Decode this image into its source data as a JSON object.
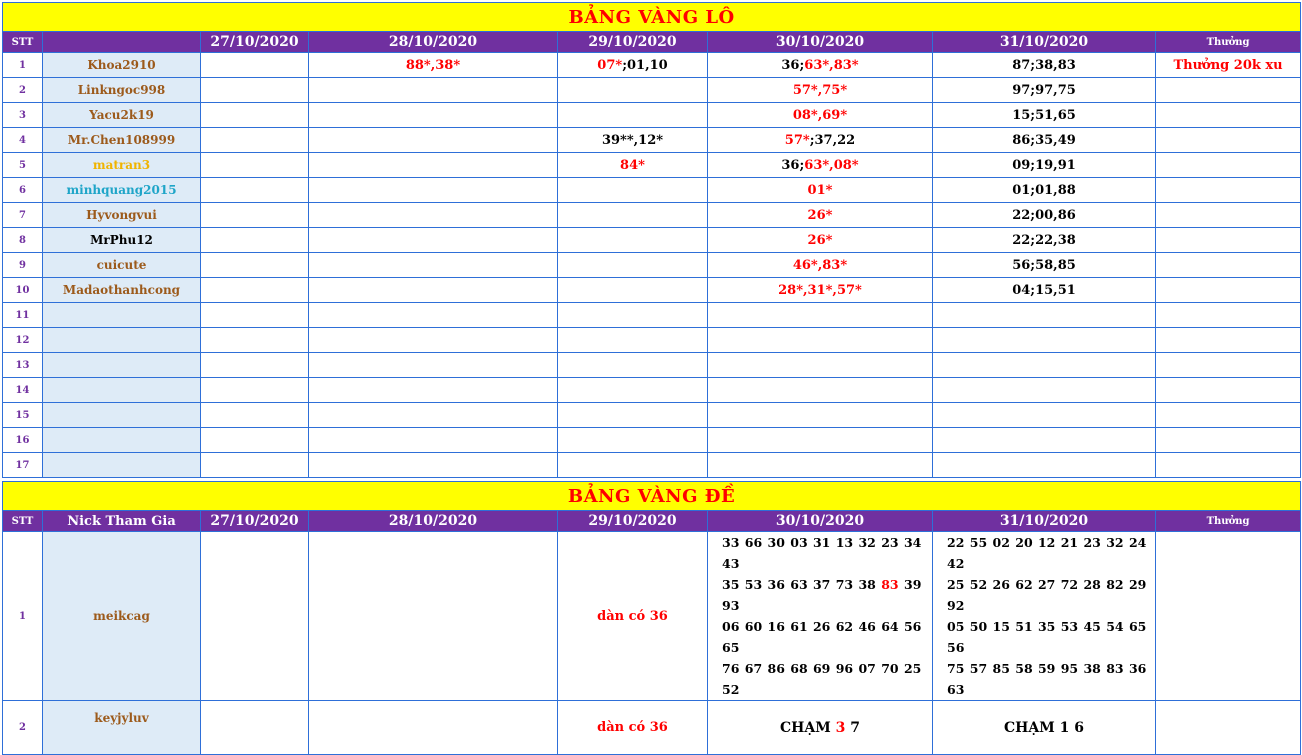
{
  "lo": {
    "title": "BẢNG VÀNG LÔ",
    "headers": {
      "stt": "STT",
      "nick": "",
      "dates": [
        "27/10/2020",
        "28/10/2020",
        "29/10/2020",
        "30/10/2020",
        "31/10/2020"
      ],
      "reward": "Thưởng"
    },
    "rows": [
      {
        "stt": "1",
        "nick": "Khoa2910",
        "nick_color": "#9c5a1b",
        "d1": [],
        "d2": [
          {
            "t": "88*,38*",
            "c": "#ff0000"
          }
        ],
        "d3": [
          {
            "t": "07*",
            "c": "#ff0000"
          },
          {
            "t": ";01,10",
            "c": "#000000"
          }
        ],
        "d4": [
          {
            "t": "36;",
            "c": "#000000"
          },
          {
            "t": "63*,83*",
            "c": "#ff0000"
          }
        ],
        "d5": [
          {
            "t": "87;38,83",
            "c": "#000000"
          }
        ],
        "reward": "Thưởng 20k xu"
      },
      {
        "stt": "2",
        "nick": "Linkngoc998",
        "nick_color": "#9c5a1b",
        "d1": [],
        "d2": [],
        "d3": [],
        "d4": [
          {
            "t": "57*,75*",
            "c": "#ff0000"
          }
        ],
        "d5": [
          {
            "t": "97;97,75",
            "c": "#000000"
          }
        ],
        "reward": ""
      },
      {
        "stt": "3",
        "nick": "Yacu2k19",
        "nick_color": "#9c5a1b",
        "d1": [],
        "d2": [],
        "d3": [],
        "d4": [
          {
            "t": "08*,69*",
            "c": "#ff0000"
          }
        ],
        "d5": [
          {
            "t": "15;51,65",
            "c": "#000000"
          }
        ],
        "reward": ""
      },
      {
        "stt": "4",
        "nick": "Mr.Chen108999",
        "nick_color": "#9c5a1b",
        "d1": [],
        "d2": [],
        "d3": [
          {
            "t": "39**,12*",
            "c": "#000000"
          }
        ],
        "d4": [
          {
            "t": "57*",
            "c": "#ff0000"
          },
          {
            "t": ";37,22",
            "c": "#000000"
          }
        ],
        "d5": [
          {
            "t": "86;35,49",
            "c": "#000000"
          }
        ],
        "reward": ""
      },
      {
        "stt": "5",
        "nick": "matran3",
        "nick_color": "#f0b400",
        "d1": [],
        "d2": [],
        "d3": [
          {
            "t": "84*",
            "c": "#ff0000"
          }
        ],
        "d4": [
          {
            "t": "36;",
            "c": "#000000"
          },
          {
            "t": "63*,08*",
            "c": "#ff0000"
          }
        ],
        "d5": [
          {
            "t": "09;19,91",
            "c": "#000000"
          }
        ],
        "reward": ""
      },
      {
        "stt": "6",
        "nick": "minhquang2015",
        "nick_color": "#1fa5c8",
        "d1": [],
        "d2": [],
        "d3": [],
        "d4": [
          {
            "t": "01*",
            "c": "#ff0000"
          }
        ],
        "d5": [
          {
            "t": "01;01,88",
            "c": "#000000"
          }
        ],
        "reward": ""
      },
      {
        "stt": "7",
        "nick": "Hyvongvui",
        "nick_color": "#9c5a1b",
        "d1": [],
        "d2": [],
        "d3": [],
        "d4": [
          {
            "t": "26*",
            "c": "#ff0000"
          }
        ],
        "d5": [
          {
            "t": "22;00,86",
            "c": "#000000"
          }
        ],
        "reward": ""
      },
      {
        "stt": "8",
        "nick": "MrPhu12",
        "nick_color": "#000000",
        "d1": [],
        "d2": [],
        "d3": [],
        "d4": [
          {
            "t": "26*",
            "c": "#ff0000"
          }
        ],
        "d5": [
          {
            "t": "22;22,38",
            "c": "#000000"
          }
        ],
        "reward": ""
      },
      {
        "stt": "9",
        "nick": "cuicute",
        "nick_color": "#9c5a1b",
        "d1": [],
        "d2": [],
        "d3": [],
        "d4": [
          {
            "t": "46*,83*",
            "c": "#ff0000"
          }
        ],
        "d5": [
          {
            "t": "56;58,85",
            "c": "#000000"
          }
        ],
        "reward": ""
      },
      {
        "stt": "10",
        "nick": "Madaothanhcong",
        "nick_color": "#9c5a1b",
        "d1": [],
        "d2": [],
        "d3": [],
        "d4": [
          {
            "t": "28*,31*,57*",
            "c": "#ff0000"
          }
        ],
        "d5": [
          {
            "t": "04;15,51",
            "c": "#000000"
          }
        ],
        "reward": ""
      },
      {
        "stt": "11",
        "nick": "",
        "nick_color": "#000000",
        "d1": [],
        "d2": [],
        "d3": [],
        "d4": [],
        "d5": [],
        "reward": ""
      },
      {
        "stt": "12",
        "nick": "",
        "nick_color": "#000000",
        "d1": [],
        "d2": [],
        "d3": [],
        "d4": [],
        "d5": [],
        "reward": ""
      },
      {
        "stt": "13",
        "nick": "",
        "nick_color": "#000000",
        "d1": [],
        "d2": [],
        "d3": [],
        "d4": [],
        "d5": [],
        "reward": ""
      },
      {
        "stt": "14",
        "nick": "",
        "nick_color": "#000000",
        "d1": [],
        "d2": [],
        "d3": [],
        "d4": [],
        "d5": [],
        "reward": ""
      },
      {
        "stt": "15",
        "nick": "",
        "nick_color": "#000000",
        "d1": [],
        "d2": [],
        "d3": [],
        "d4": [],
        "d5": [],
        "reward": ""
      },
      {
        "stt": "16",
        "nick": "",
        "nick_color": "#000000",
        "d1": [],
        "d2": [],
        "d3": [],
        "d4": [],
        "d5": [],
        "reward": ""
      },
      {
        "stt": "17",
        "nick": "",
        "nick_color": "#000000",
        "d1": [],
        "d2": [],
        "d3": [],
        "d4": [],
        "d5": [],
        "reward": ""
      }
    ]
  },
  "de": {
    "title": "BẢNG VÀNG ĐỀ",
    "headers": {
      "stt": "STT",
      "nick": "Nick Tham Gia",
      "dates": [
        "27/10/2020",
        "28/10/2020",
        "29/10/2020",
        "30/10/2020",
        "31/10/2020"
      ],
      "reward": "Thưởng"
    },
    "rows": [
      {
        "stt": "1",
        "nick": "meikcag",
        "d3": "dàn có 36",
        "d4_lines": [
          [
            {
              "t": "33 66 30 03 31 13 32 23 34 43",
              "c": "#000000"
            }
          ],
          [
            {
              "t": "35 53 36 63 37 73 38 ",
              "c": "#000000"
            },
            {
              "t": "83",
              "c": "#ff0000"
            },
            {
              "t": " 39 93",
              "c": "#000000"
            }
          ],
          [
            {
              "t": "06 60 16 61 26 62 46 64 56 65",
              "c": "#000000"
            }
          ],
          [
            {
              "t": "76 67 86 68 69 96 07 70 25 52",
              "c": "#000000"
            }
          ]
        ],
        "d5_lines": [
          [
            {
              "t": "22 55 02 20 12 21 23 32 24 42",
              "c": "#000000"
            }
          ],
          [
            {
              "t": "25 52 26 62 27 72 28 82 29 92",
              "c": "#000000"
            }
          ],
          [
            {
              "t": "05 50 15 51 35 53 45 54 65 56",
              "c": "#000000"
            }
          ],
          [
            {
              "t": "75 57 85 58 59 95 38 83 36 63",
              "c": "#000000"
            }
          ]
        ]
      },
      {
        "stt": "2",
        "nick": "keyjyluv",
        "d3": "dàn có 36",
        "d4_cham": [
          {
            "t": "CHẠM ",
            "c": "#000000"
          },
          {
            "t": "3",
            "c": "#ff0000"
          },
          {
            "t": " 7",
            "c": "#000000"
          }
        ],
        "d5_cham": [
          {
            "t": "CHẠM 1 6",
            "c": "#000000"
          }
        ]
      }
    ]
  }
}
